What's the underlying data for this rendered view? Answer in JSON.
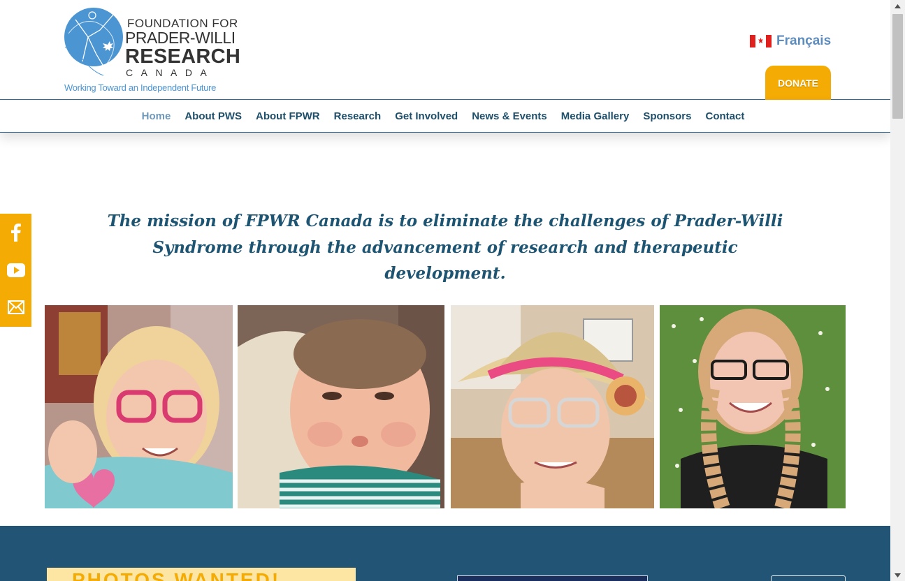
{
  "header": {
    "logo": {
      "line1": "FOUNDATION FOR",
      "line2": "PRADER-WILLI",
      "line3": "RESEARCH",
      "line4": "CANADA",
      "tagline": "Working Toward an Independent Future"
    },
    "language": {
      "label": "Français",
      "flag_icon": "canada-flag-icon"
    },
    "donate_label": "DONATE"
  },
  "nav": {
    "items": [
      {
        "label": "Home",
        "active": true
      },
      {
        "label": "About PWS"
      },
      {
        "label": "About FPWR"
      },
      {
        "label": "Research"
      },
      {
        "label": "Get Involved"
      },
      {
        "label": "News & Events"
      },
      {
        "label": "Media Gallery"
      },
      {
        "label": "Sponsors"
      },
      {
        "label": "Contact"
      }
    ]
  },
  "mission": {
    "text": "The mission of FPWR Canada is to eliminate the challenges of Prader-Willi Syndrome through the advancement of research and therapeutic development."
  },
  "social": [
    {
      "icon": "facebook-icon"
    },
    {
      "icon": "youtube-icon"
    },
    {
      "icon": "email-icon"
    }
  ],
  "photos": [
    {
      "icon": "photo-toddler-pink-glasses"
    },
    {
      "icon": "photo-baby-striped-shirt"
    },
    {
      "icon": "photo-girl-straw-hat"
    },
    {
      "icon": "photo-young-woman-braids"
    }
  ],
  "band": {
    "banner_text": "PHOTOS WANTED!"
  },
  "colors": {
    "brand_blue": "#1d4f6b",
    "accent_orange": "#f4ab04",
    "band_blue": "#225575",
    "logo_blue": "#4b95d3"
  }
}
